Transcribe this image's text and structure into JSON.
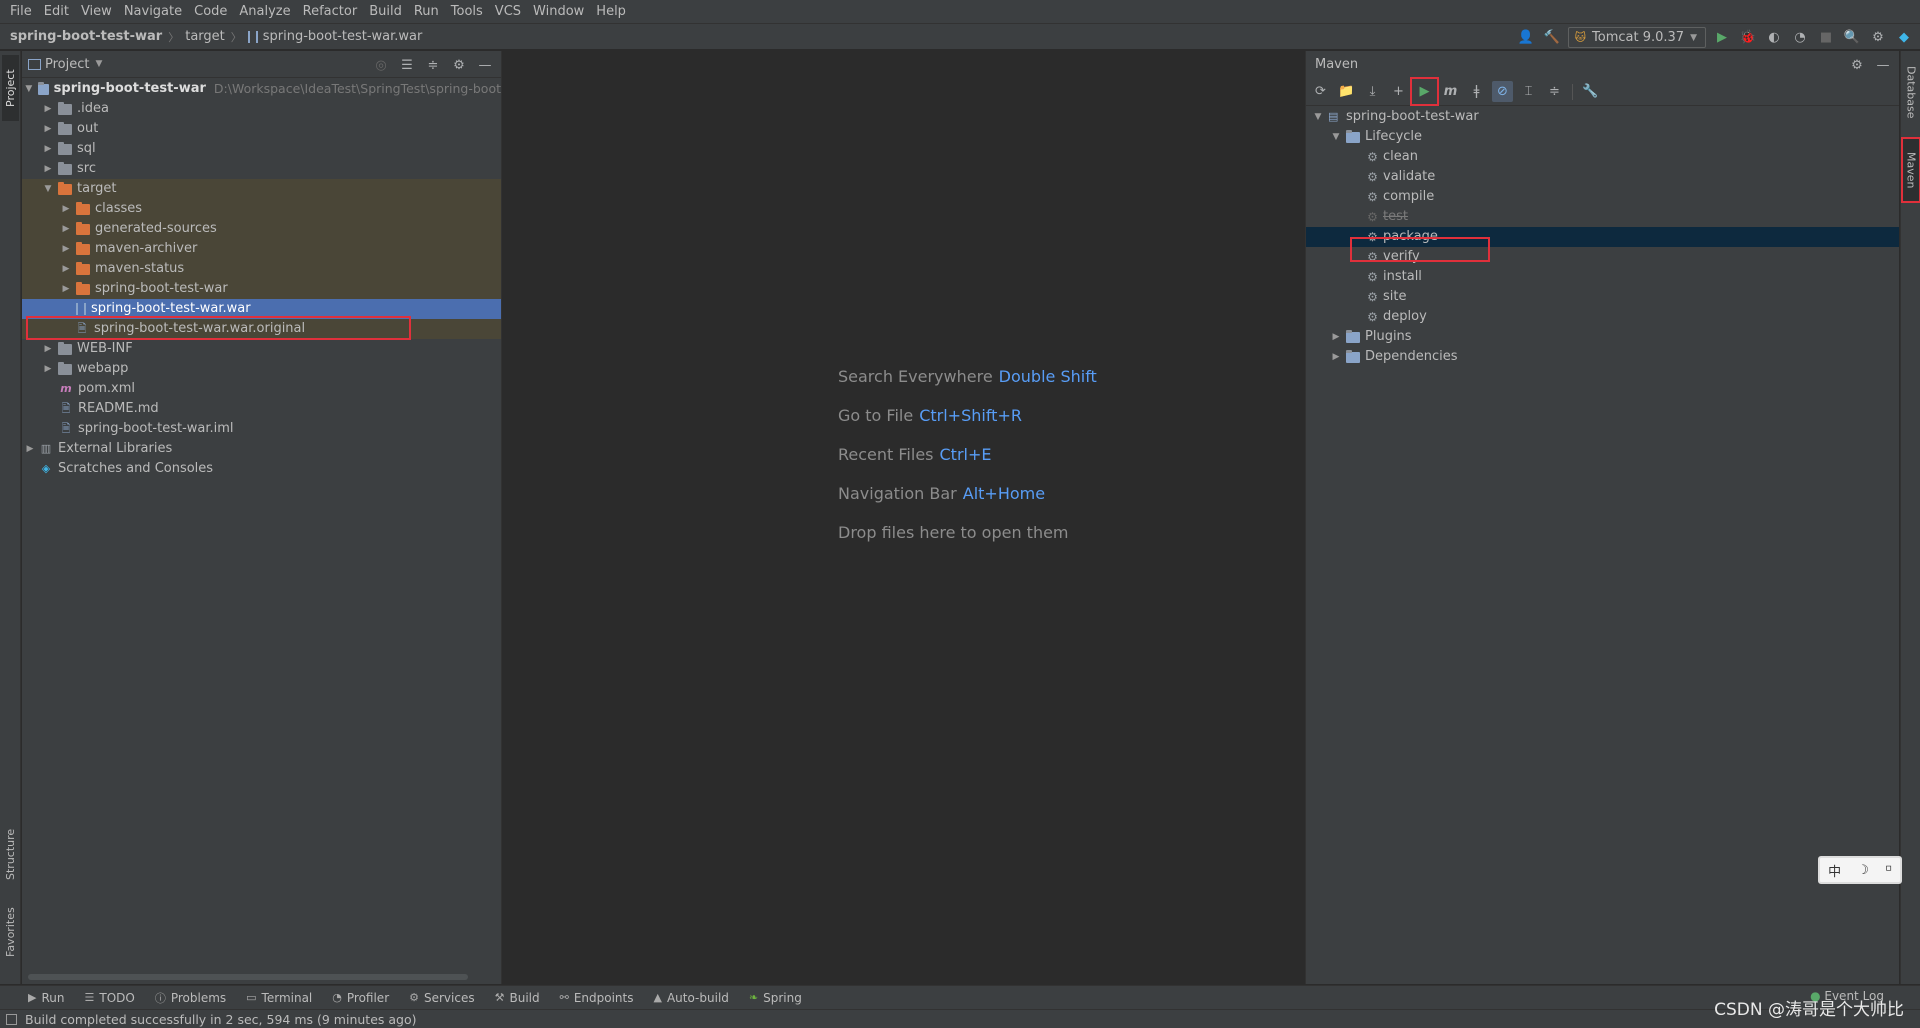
{
  "menu": [
    "File",
    "Edit",
    "View",
    "Navigate",
    "Code",
    "Analyze",
    "Refactor",
    "Build",
    "Run",
    "Tools",
    "VCS",
    "Window",
    "Help"
  ],
  "breadcrumb": {
    "project": "spring-boot-test-war",
    "folder": "target",
    "file": "spring-boot-test-war.war"
  },
  "run_config": "Tomcat 9.0.37",
  "left_tabs": {
    "project": "Project",
    "structure": "Structure",
    "favorites": "Favorites"
  },
  "project_panel": {
    "title": "Project",
    "root": {
      "name": "spring-boot-test-war",
      "path": "D:\\Workspace\\IdeaTest\\SpringTest\\spring-boot"
    },
    "items": {
      "idea": ".idea",
      "out": "out",
      "sql": "sql",
      "src": "src",
      "target": "target",
      "classes": "classes",
      "generated_sources": "generated-sources",
      "maven_archiver": "maven-archiver",
      "maven_status": "maven-status",
      "spring_dir": "spring-boot-test-war",
      "war": "spring-boot-test-war.war",
      "war_original": "spring-boot-test-war.war.original",
      "web_inf": "WEB-INF",
      "webapp": "webapp",
      "pom": "pom.xml",
      "readme": "README.md",
      "iml": "spring-boot-test-war.iml",
      "ext_libs": "External Libraries",
      "scratches": "Scratches and Consoles"
    }
  },
  "editor_hints": [
    {
      "label": "Search Everywhere",
      "key": "Double Shift"
    },
    {
      "label": "Go to File",
      "key": "Ctrl+Shift+R"
    },
    {
      "label": "Recent Files",
      "key": "Ctrl+E"
    },
    {
      "label": "Navigation Bar",
      "key": "Alt+Home"
    },
    {
      "label": "Drop files here to open them",
      "key": ""
    }
  ],
  "maven": {
    "title": "Maven",
    "project": "spring-boot-test-war",
    "lifecycle": "Lifecycle",
    "phases": [
      "clean",
      "validate",
      "compile",
      "test",
      "package",
      "verify",
      "install",
      "site",
      "deploy"
    ],
    "plugins": "Plugins",
    "dependencies": "Dependencies"
  },
  "right_tabs": {
    "database": "Database",
    "maven": "Maven"
  },
  "bottom_tabs": [
    "Run",
    "TODO",
    "Problems",
    "Terminal",
    "Profiler",
    "Services",
    "Build",
    "Endpoints",
    "Auto-build",
    "Spring"
  ],
  "status": "Build completed successfully in 2 sec, 594 ms (9 minutes ago)",
  "event_log": "Event Log",
  "watermark": "CSDN @涛哥是个大帅比",
  "ime": {
    "a": "中",
    "b": "☽",
    "c": "⸋"
  },
  "colors": {
    "accent": "#4b6eaf",
    "highlight_box": "#e0303b",
    "link": "#589df6"
  }
}
